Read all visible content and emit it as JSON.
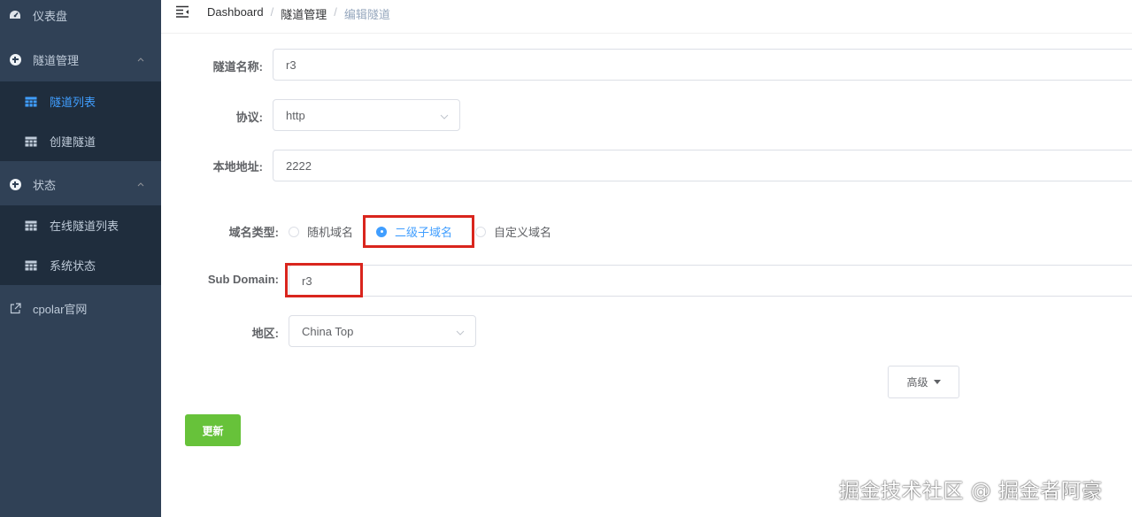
{
  "sidebar": {
    "dashboard_label": "仪表盘",
    "tunnel_mgmt_label": "隧道管理",
    "tunnel_list_label": "隧道列表",
    "create_tunnel_label": "创建隧道",
    "status_label": "状态",
    "online_tunnels_label": "在线隧道列表",
    "system_status_label": "系统状态",
    "cpolar_site_label": "cpolar官网"
  },
  "breadcrumb": {
    "home": "Dashboard",
    "sep": "/",
    "section": "隧道管理",
    "current": "编辑隧道"
  },
  "form": {
    "name_label": "隧道名称:",
    "name_value": "r3",
    "protocol_label": "协议:",
    "protocol_value": "http",
    "local_addr_label": "本地地址:",
    "local_addr_value": "2222",
    "domain_type_label": "域名类型:",
    "domain_options": [
      "随机域名",
      "二级子域名",
      "自定义域名"
    ],
    "domain_selected": "二级子域名",
    "subdomain_label": "Sub Domain:",
    "subdomain_value": "r3",
    "region_label": "地区:",
    "region_value": "China Top",
    "advanced_label": "高级",
    "update_label": "更新"
  },
  "watermark": "掘金技术社区 @ 掘金者阿豪",
  "colors": {
    "sidebar_bg": "#304156",
    "submenu_bg": "#1f2d3d",
    "accent": "#409eff",
    "success": "#67c23a",
    "highlight_box": "#d9251d"
  }
}
